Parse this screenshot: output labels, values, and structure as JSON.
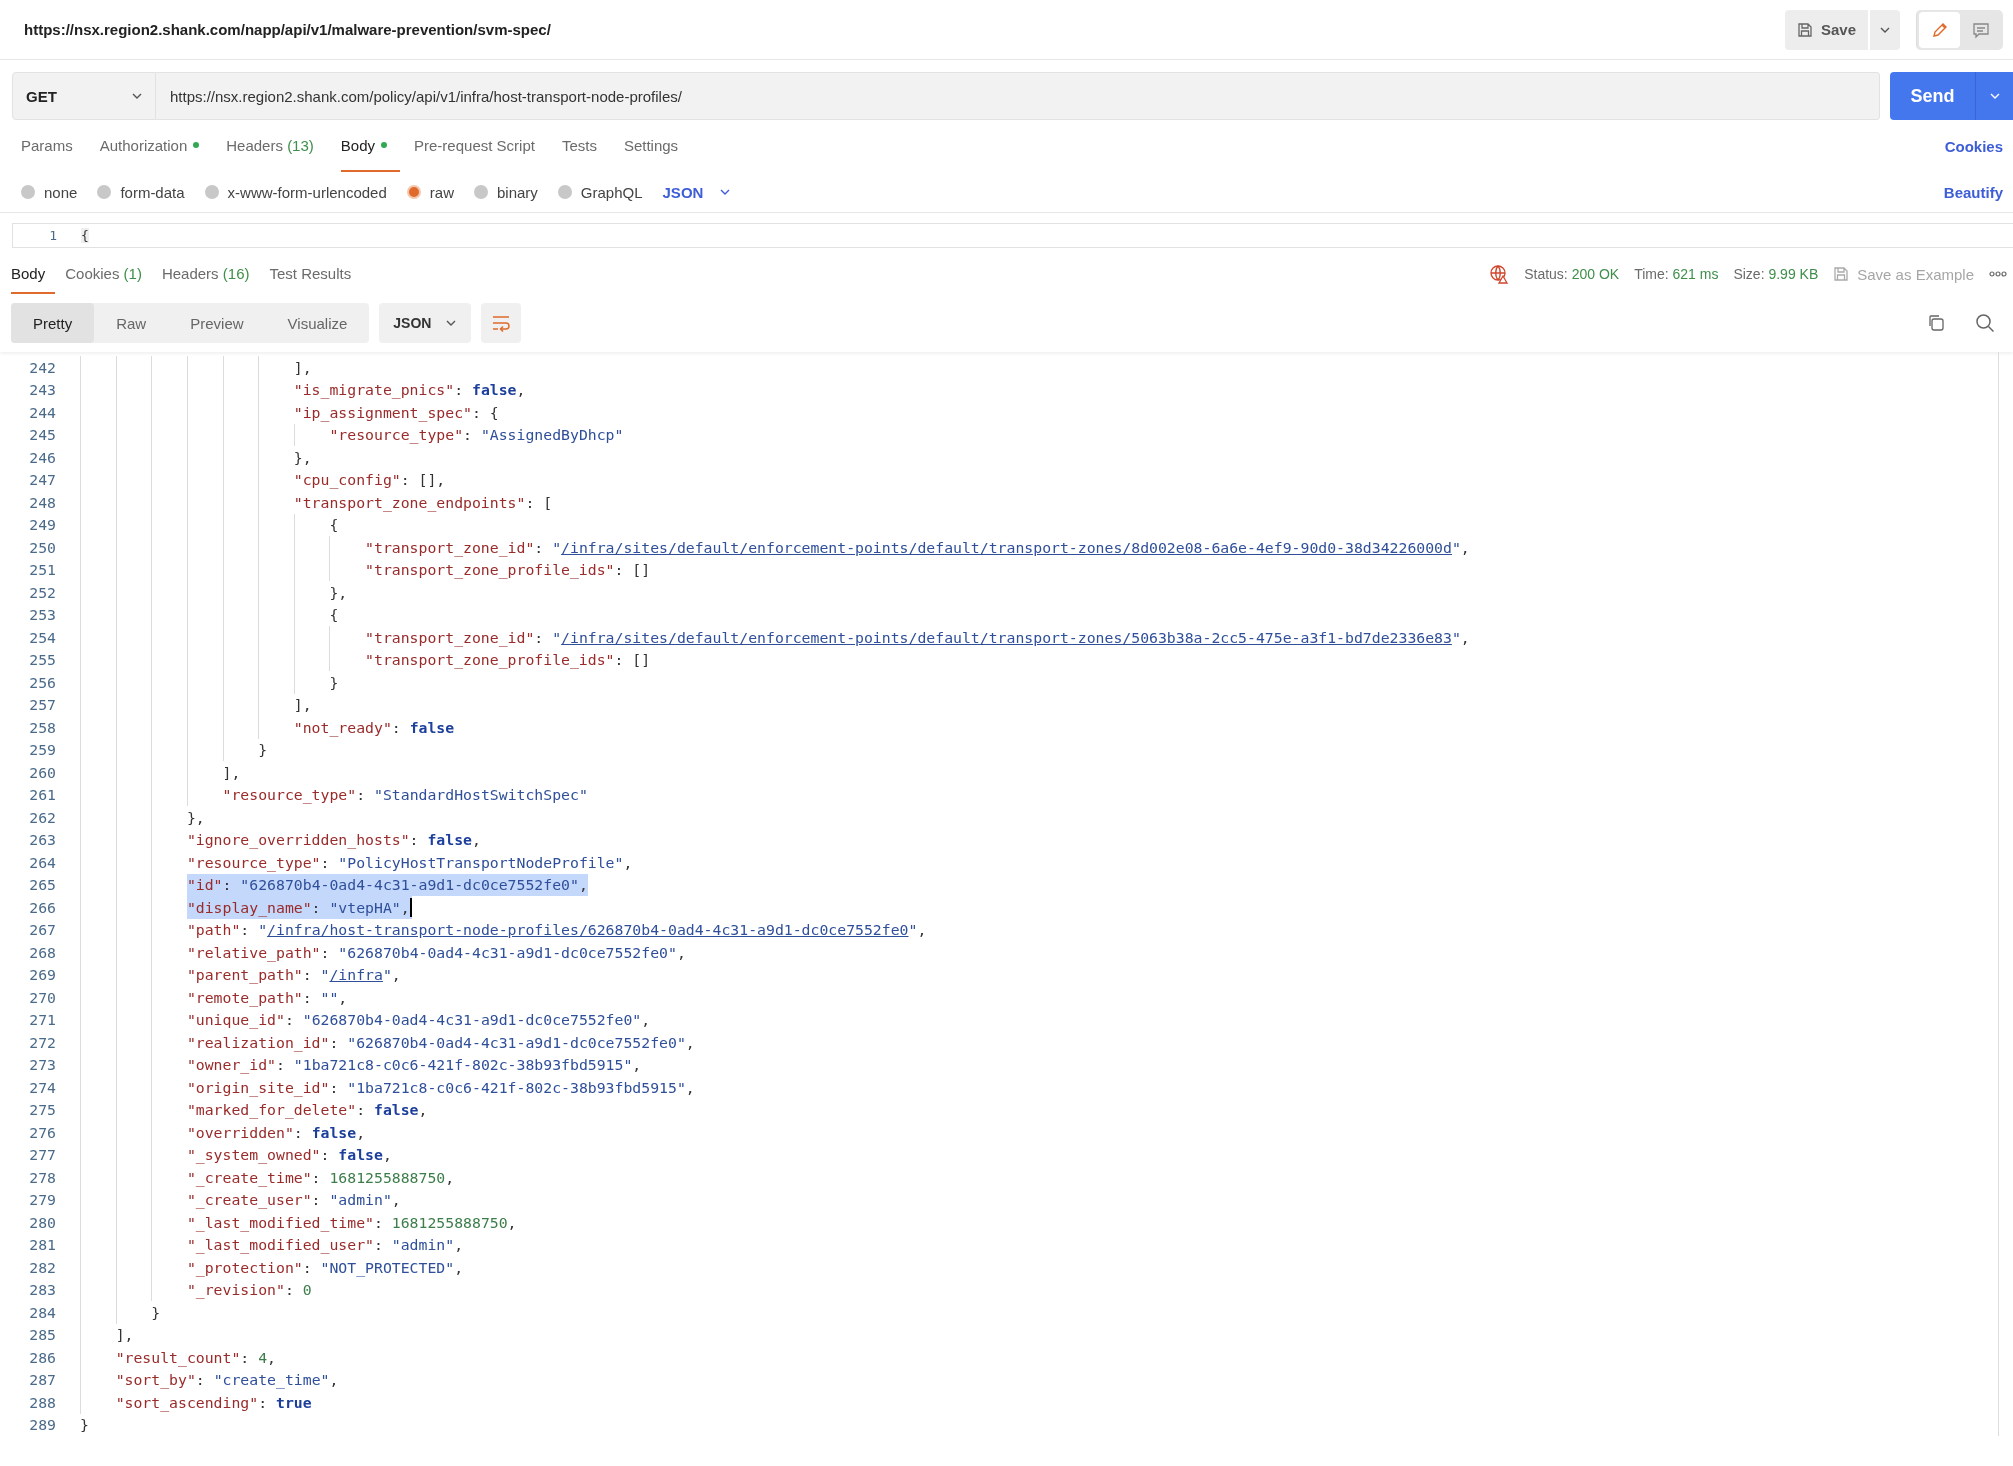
{
  "header": {
    "title": "https://nsx.region2.shank.com/napp/api/v1/malware-prevention/svm-spec/",
    "save_label": "Save",
    "modes": [
      {
        "kind": "edit",
        "selected": true
      },
      {
        "kind": "comment",
        "selected": false
      }
    ]
  },
  "request": {
    "method": "GET",
    "url": "https://nsx.region2.shank.com/policy/api/v1/infra/host-transport-node-profiles/",
    "send_label": "Send"
  },
  "request_tabs": [
    {
      "label": "Params",
      "indicator": false,
      "selected": false
    },
    {
      "label": "Authorization",
      "indicator": true,
      "selected": false
    },
    {
      "label": "Headers",
      "count": "(13)",
      "indicator": false,
      "selected": false
    },
    {
      "label": "Body",
      "indicator": true,
      "selected": true
    },
    {
      "label": "Pre-request Script",
      "indicator": false,
      "selected": false
    },
    {
      "label": "Tests",
      "indicator": false,
      "selected": false
    },
    {
      "label": "Settings",
      "indicator": false,
      "selected": false
    }
  ],
  "cookies_link": "Cookies",
  "body_types": [
    {
      "label": "none",
      "selected": false
    },
    {
      "label": "form-data",
      "selected": false
    },
    {
      "label": "x-www-form-urlencoded",
      "selected": false
    },
    {
      "label": "raw",
      "selected": true
    },
    {
      "label": "binary",
      "selected": false
    },
    {
      "label": "GraphQL",
      "selected": false
    }
  ],
  "body_format": "JSON",
  "beautify_link": "Beautify",
  "request_editor": {
    "line_number": "1",
    "text": "{"
  },
  "response_tabs": [
    {
      "label": "Body",
      "selected": true
    },
    {
      "label": "Cookies",
      "count": "(1)",
      "selected": false
    },
    {
      "label": "Headers",
      "count": "(16)",
      "selected": false
    },
    {
      "label": "Test Results",
      "selected": false
    }
  ],
  "status": [
    {
      "label": "Status:",
      "value": "200 OK"
    },
    {
      "label": "Time:",
      "value": "621 ms"
    },
    {
      "label": "Size:",
      "value": "9.99 KB"
    }
  ],
  "save_example": {
    "label": "Save as Example",
    "disabled": true
  },
  "view_tabs": [
    {
      "label": "Pretty",
      "selected": true
    },
    {
      "label": "Raw",
      "selected": false
    },
    {
      "label": "Preview",
      "selected": false
    },
    {
      "label": "Visualize",
      "selected": false
    }
  ],
  "response_format": "JSON",
  "code_lines": [
    {
      "children": [
        {
          "children": [
            {
              "children": [
                {
                  "children": [
                    {
                      "children": [
                        {
                          "children": [
                            {
                              "number": "242",
                              "selected": false,
                              "cursor": false,
                              "tokens": [
                                {
                                  "kind": "punct",
                                  "text": "],"
                                }
                              ]
                            },
                            {
                              "number": "243",
                              "selected": false,
                              "cursor": false,
                              "tokens": [
                                {
                                  "kind": "key",
                                  "text": "\"is_migrate_pnics\""
                                },
                                {
                                  "kind": "punct",
                                  "text": ": "
                                },
                                {
                                  "kind": "bool",
                                  "text": "false"
                                },
                                {
                                  "kind": "punct",
                                  "text": ","
                                }
                              ]
                            },
                            {
                              "number": "244",
                              "selected": false,
                              "cursor": false,
                              "tokens": [
                                {
                                  "kind": "key",
                                  "text": "\"ip_assignment_spec\""
                                },
                                {
                                  "kind": "punct",
                                  "text": ": {"
                                }
                              ],
                              "children": [
                                {
                                  "number": "245",
                                  "selected": false,
                                  "cursor": false,
                                  "tokens": [
                                    {
                                      "kind": "key",
                                      "text": "\"resource_type\""
                                    },
                                    {
                                      "kind": "punct",
                                      "text": ": "
                                    },
                                    {
                                      "kind": "string",
                                      "text": "\"AssignedByDhcp\""
                                    }
                                  ]
                                }
                              ]
                            },
                            {
                              "number": "246",
                              "selected": false,
                              "cursor": false,
                              "tokens": [
                                {
                                  "kind": "punct",
                                  "text": "},"
                                }
                              ]
                            },
                            {
                              "number": "247",
                              "selected": false,
                              "cursor": false,
                              "tokens": [
                                {
                                  "kind": "key",
                                  "text": "\"cpu_config\""
                                },
                                {
                                  "kind": "punct",
                                  "text": ": [],"
                                }
                              ]
                            },
                            {
                              "number": "248",
                              "selected": false,
                              "cursor": false,
                              "tokens": [
                                {
                                  "kind": "key",
                                  "text": "\"transport_zone_endpoints\""
                                },
                                {
                                  "kind": "punct",
                                  "text": ": ["
                                }
                              ],
                              "children": [
                                {
                                  "number": "249",
                                  "selected": false,
                                  "cursor": false,
                                  "tokens": [
                                    {
                                      "kind": "punct",
                                      "text": "{"
                                    }
                                  ],
                                  "children": [
                                    {
                                      "number": "250",
                                      "selected": false,
                                      "cursor": false,
                                      "tokens": [
                                        {
                                          "kind": "key",
                                          "text": "\"transport_zone_id\""
                                        },
                                        {
                                          "kind": "punct",
                                          "text": ": "
                                        },
                                        {
                                          "kind": "string",
                                          "text": "\""
                                        },
                                        {
                                          "kind": "link",
                                          "text": "/infra/sites/default/enforcement-points/default/transport-zones/8d002e08-6a6e-4ef9-90d0-38d34226000d"
                                        },
                                        {
                                          "kind": "string",
                                          "text": "\""
                                        },
                                        {
                                          "kind": "punct",
                                          "text": ","
                                        }
                                      ]
                                    },
                                    {
                                      "number": "251",
                                      "selected": false,
                                      "cursor": false,
                                      "tokens": [
                                        {
                                          "kind": "key",
                                          "text": "\"transport_zone_profile_ids\""
                                        },
                                        {
                                          "kind": "punct",
                                          "text": ": []"
                                        }
                                      ]
                                    }
                                  ]
                                },
                                {
                                  "number": "252",
                                  "selected": false,
                                  "cursor": false,
                                  "tokens": [
                                    {
                                      "kind": "punct",
                                      "text": "},"
                                    }
                                  ]
                                },
                                {
                                  "number": "253",
                                  "selected": false,
                                  "cursor": false,
                                  "tokens": [
                                    {
                                      "kind": "punct",
                                      "text": "{"
                                    }
                                  ],
                                  "children": [
                                    {
                                      "number": "254",
                                      "selected": false,
                                      "cursor": false,
                                      "tokens": [
                                        {
                                          "kind": "key",
                                          "text": "\"transport_zone_id\""
                                        },
                                        {
                                          "kind": "punct",
                                          "text": ": "
                                        },
                                        {
                                          "kind": "string",
                                          "text": "\""
                                        },
                                        {
                                          "kind": "link",
                                          "text": "/infra/sites/default/enforcement-points/default/transport-zones/5063b38a-2cc5-475e-a3f1-bd7de2336e83"
                                        },
                                        {
                                          "kind": "string",
                                          "text": "\""
                                        },
                                        {
                                          "kind": "punct",
                                          "text": ","
                                        }
                                      ]
                                    },
                                    {
                                      "number": "255",
                                      "selected": false,
                                      "cursor": false,
                                      "tokens": [
                                        {
                                          "kind": "key",
                                          "text": "\"transport_zone_profile_ids\""
                                        },
                                        {
                                          "kind": "punct",
                                          "text": ": []"
                                        }
                                      ]
                                    }
                                  ]
                                },
                                {
                                  "number": "256",
                                  "selected": false,
                                  "cursor": false,
                                  "tokens": [
                                    {
                                      "kind": "punct",
                                      "text": "}"
                                    }
                                  ]
                                }
                              ]
                            },
                            {
                              "number": "257",
                              "selected": false,
                              "cursor": false,
                              "tokens": [
                                {
                                  "kind": "punct",
                                  "text": "],"
                                }
                              ]
                            },
                            {
                              "number": "258",
                              "selected": false,
                              "cursor": false,
                              "tokens": [
                                {
                                  "kind": "key",
                                  "text": "\"not_ready\""
                                },
                                {
                                  "kind": "punct",
                                  "text": ": "
                                },
                                {
                                  "kind": "bool",
                                  "text": "false"
                                }
                              ]
                            }
                          ]
                        },
                        {
                          "number": "259",
                          "selected": false,
                          "cursor": false,
                          "tokens": [
                            {
                              "kind": "punct",
                              "text": "}"
                            }
                          ]
                        }
                      ]
                    },
                    {
                      "number": "260",
                      "selected": false,
                      "cursor": false,
                      "tokens": [
                        {
                          "kind": "punct",
                          "text": "],"
                        }
                      ]
                    },
                    {
                      "number": "261",
                      "selected": false,
                      "cursor": false,
                      "tokens": [
                        {
                          "kind": "key",
                          "text": "\"resource_type\""
                        },
                        {
                          "kind": "punct",
                          "text": ": "
                        },
                        {
                          "kind": "string",
                          "text": "\"StandardHostSwitchSpec\""
                        }
                      ]
                    }
                  ]
                },
                {
                  "number": "262",
                  "selected": false,
                  "cursor": false,
                  "tokens": [
                    {
                      "kind": "punct",
                      "text": "},"
                    }
                  ]
                },
                {
                  "number": "263",
                  "selected": false,
                  "cursor": false,
                  "tokens": [
                    {
                      "kind": "key",
                      "text": "\"ignore_overridden_hosts\""
                    },
                    {
                      "kind": "punct",
                      "text": ": "
                    },
                    {
                      "kind": "bool",
                      "text": "false"
                    },
                    {
                      "kind": "punct",
                      "text": ","
                    }
                  ]
                },
                {
                  "number": "264",
                  "selected": false,
                  "cursor": false,
                  "tokens": [
                    {
                      "kind": "key",
                      "text": "\"resource_type\""
                    },
                    {
                      "kind": "punct",
                      "text": ": "
                    },
                    {
                      "kind": "string",
                      "text": "\"PolicyHostTransportNodeProfile\""
                    },
                    {
                      "kind": "punct",
                      "text": ","
                    }
                  ]
                },
                {
                  "number": "265",
                  "selected": true,
                  "cursor": false,
                  "tokens": [
                    {
                      "kind": "key",
                      "text": "\"id\""
                    },
                    {
                      "kind": "punct",
                      "text": ": "
                    },
                    {
                      "kind": "string",
                      "text": "\"626870b4-0ad4-4c31-a9d1-dc0ce7552fe0\""
                    },
                    {
                      "kind": "punct",
                      "text": ","
                    }
                  ]
                },
                {
                  "number": "266",
                  "selected": true,
                  "cursor": true,
                  "tokens": [
                    {
                      "kind": "key",
                      "text": "\"display_name\""
                    },
                    {
                      "kind": "punct",
                      "text": ": "
                    },
                    {
                      "kind": "string",
                      "text": "\"vtepHA\""
                    },
                    {
                      "kind": "punct",
                      "text": ","
                    }
                  ]
                },
                {
                  "number": "267",
                  "selected": false,
                  "cursor": false,
                  "tokens": [
                    {
                      "kind": "key",
                      "text": "\"path\""
                    },
                    {
                      "kind": "punct",
                      "text": ": "
                    },
                    {
                      "kind": "string",
                      "text": "\""
                    },
                    {
                      "kind": "link",
                      "text": "/infra/host-transport-node-profiles/626870b4-0ad4-4c31-a9d1-dc0ce7552fe0"
                    },
                    {
                      "kind": "string",
                      "text": "\""
                    },
                    {
                      "kind": "punct",
                      "text": ","
                    }
                  ]
                },
                {
                  "number": "268",
                  "selected": false,
                  "cursor": false,
                  "tokens": [
                    {
                      "kind": "key",
                      "text": "\"relative_path\""
                    },
                    {
                      "kind": "punct",
                      "text": ": "
                    },
                    {
                      "kind": "string",
                      "text": "\"626870b4-0ad4-4c31-a9d1-dc0ce7552fe0\""
                    },
                    {
                      "kind": "punct",
                      "text": ","
                    }
                  ]
                },
                {
                  "number": "269",
                  "selected": false,
                  "cursor": false,
                  "tokens": [
                    {
                      "kind": "key",
                      "text": "\"parent_path\""
                    },
                    {
                      "kind": "punct",
                      "text": ": "
                    },
                    {
                      "kind": "string",
                      "text": "\""
                    },
                    {
                      "kind": "link",
                      "text": "/infra"
                    },
                    {
                      "kind": "string",
                      "text": "\""
                    },
                    {
                      "kind": "punct",
                      "text": ","
                    }
                  ]
                },
                {
                  "number": "270",
                  "selected": false,
                  "cursor": false,
                  "tokens": [
                    {
                      "kind": "key",
                      "text": "\"remote_path\""
                    },
                    {
                      "kind": "punct",
                      "text": ": "
                    },
                    {
                      "kind": "string",
                      "text": "\"\""
                    },
                    {
                      "kind": "punct",
                      "text": ","
                    }
                  ]
                },
                {
                  "number": "271",
                  "selected": false,
                  "cursor": false,
                  "tokens": [
                    {
                      "kind": "key",
                      "text": "\"unique_id\""
                    },
                    {
                      "kind": "punct",
                      "text": ": "
                    },
                    {
                      "kind": "string",
                      "text": "\"626870b4-0ad4-4c31-a9d1-dc0ce7552fe0\""
                    },
                    {
                      "kind": "punct",
                      "text": ","
                    }
                  ]
                },
                {
                  "number": "272",
                  "selected": false,
                  "cursor": false,
                  "tokens": [
                    {
                      "kind": "key",
                      "text": "\"realization_id\""
                    },
                    {
                      "kind": "punct",
                      "text": ": "
                    },
                    {
                      "kind": "string",
                      "text": "\"626870b4-0ad4-4c31-a9d1-dc0ce7552fe0\""
                    },
                    {
                      "kind": "punct",
                      "text": ","
                    }
                  ]
                },
                {
                  "number": "273",
                  "selected": false,
                  "cursor": false,
                  "tokens": [
                    {
                      "kind": "key",
                      "text": "\"owner_id\""
                    },
                    {
                      "kind": "punct",
                      "text": ": "
                    },
                    {
                      "kind": "string",
                      "text": "\"1ba721c8-c0c6-421f-802c-38b93fbd5915\""
                    },
                    {
                      "kind": "punct",
                      "text": ","
                    }
                  ]
                },
                {
                  "number": "274",
                  "selected": false,
                  "cursor": false,
                  "tokens": [
                    {
                      "kind": "key",
                      "text": "\"origin_site_id\""
                    },
                    {
                      "kind": "punct",
                      "text": ": "
                    },
                    {
                      "kind": "string",
                      "text": "\"1ba721c8-c0c6-421f-802c-38b93fbd5915\""
                    },
                    {
                      "kind": "punct",
                      "text": ","
                    }
                  ]
                },
                {
                  "number": "275",
                  "selected": false,
                  "cursor": false,
                  "tokens": [
                    {
                      "kind": "key",
                      "text": "\"marked_for_delete\""
                    },
                    {
                      "kind": "punct",
                      "text": ": "
                    },
                    {
                      "kind": "bool",
                      "text": "false"
                    },
                    {
                      "kind": "punct",
                      "text": ","
                    }
                  ]
                },
                {
                  "number": "276",
                  "selected": false,
                  "cursor": false,
                  "tokens": [
                    {
                      "kind": "key",
                      "text": "\"overridden\""
                    },
                    {
                      "kind": "punct",
                      "text": ": "
                    },
                    {
                      "kind": "bool",
                      "text": "false"
                    },
                    {
                      "kind": "punct",
                      "text": ","
                    }
                  ]
                },
                {
                  "number": "277",
                  "selected": false,
                  "cursor": false,
                  "tokens": [
                    {
                      "kind": "key",
                      "text": "\"_system_owned\""
                    },
                    {
                      "kind": "punct",
                      "text": ": "
                    },
                    {
                      "kind": "bool",
                      "text": "false"
                    },
                    {
                      "kind": "punct",
                      "text": ","
                    }
                  ]
                },
                {
                  "number": "278",
                  "selected": false,
                  "cursor": false,
                  "tokens": [
                    {
                      "kind": "key",
                      "text": "\"_create_time\""
                    },
                    {
                      "kind": "punct",
                      "text": ": "
                    },
                    {
                      "kind": "number",
                      "text": "1681255888750"
                    },
                    {
                      "kind": "punct",
                      "text": ","
                    }
                  ]
                },
                {
                  "number": "279",
                  "selected": false,
                  "cursor": false,
                  "tokens": [
                    {
                      "kind": "key",
                      "text": "\"_create_user\""
                    },
                    {
                      "kind": "punct",
                      "text": ": "
                    },
                    {
                      "kind": "string",
                      "text": "\"admin\""
                    },
                    {
                      "kind": "punct",
                      "text": ","
                    }
                  ]
                },
                {
                  "number": "280",
                  "selected": false,
                  "cursor": false,
                  "tokens": [
                    {
                      "kind": "key",
                      "text": "\"_last_modified_time\""
                    },
                    {
                      "kind": "punct",
                      "text": ": "
                    },
                    {
                      "kind": "number",
                      "text": "1681255888750"
                    },
                    {
                      "kind": "punct",
                      "text": ","
                    }
                  ]
                },
                {
                  "number": "281",
                  "selected": false,
                  "cursor": false,
                  "tokens": [
                    {
                      "kind": "key",
                      "text": "\"_last_modified_user\""
                    },
                    {
                      "kind": "punct",
                      "text": ": "
                    },
                    {
                      "kind": "string",
                      "text": "\"admin\""
                    },
                    {
                      "kind": "punct",
                      "text": ","
                    }
                  ]
                },
                {
                  "number": "282",
                  "selected": false,
                  "cursor": false,
                  "tokens": [
                    {
                      "kind": "key",
                      "text": "\"_protection\""
                    },
                    {
                      "kind": "punct",
                      "text": ": "
                    },
                    {
                      "kind": "string",
                      "text": "\"NOT_PROTECTED\""
                    },
                    {
                      "kind": "punct",
                      "text": ","
                    }
                  ]
                },
                {
                  "number": "283",
                  "selected": false,
                  "cursor": false,
                  "tokens": [
                    {
                      "kind": "key",
                      "text": "\"_revision\""
                    },
                    {
                      "kind": "punct",
                      "text": ": "
                    },
                    {
                      "kind": "number",
                      "text": "0"
                    }
                  ]
                }
              ]
            },
            {
              "number": "284",
              "selected": false,
              "cursor": false,
              "tokens": [
                {
                  "kind": "punct",
                  "text": "}"
                }
              ]
            }
          ]
        },
        {
          "number": "285",
          "selected": false,
          "cursor": false,
          "tokens": [
            {
              "kind": "punct",
              "text": "],"
            }
          ]
        },
        {
          "number": "286",
          "selected": false,
          "cursor": false,
          "tokens": [
            {
              "kind": "key",
              "text": "\"result_count\""
            },
            {
              "kind": "punct",
              "text": ": "
            },
            {
              "kind": "number",
              "text": "4"
            },
            {
              "kind": "punct",
              "text": ","
            }
          ]
        },
        {
          "number": "287",
          "selected": false,
          "cursor": false,
          "tokens": [
            {
              "kind": "key",
              "text": "\"sort_by\""
            },
            {
              "kind": "punct",
              "text": ": "
            },
            {
              "kind": "string",
              "text": "\"create_time\""
            },
            {
              "kind": "punct",
              "text": ","
            }
          ]
        },
        {
          "number": "288",
          "selected": false,
          "cursor": false,
          "tokens": [
            {
              "kind": "key",
              "text": "\"sort_ascending\""
            },
            {
              "kind": "punct",
              "text": ": "
            },
            {
              "kind": "bool",
              "text": "true"
            }
          ]
        }
      ]
    },
    {
      "number": "289",
      "selected": false,
      "cursor": false,
      "tokens": [
        {
          "kind": "punct",
          "text": "}"
        }
      ]
    }
  ]
}
